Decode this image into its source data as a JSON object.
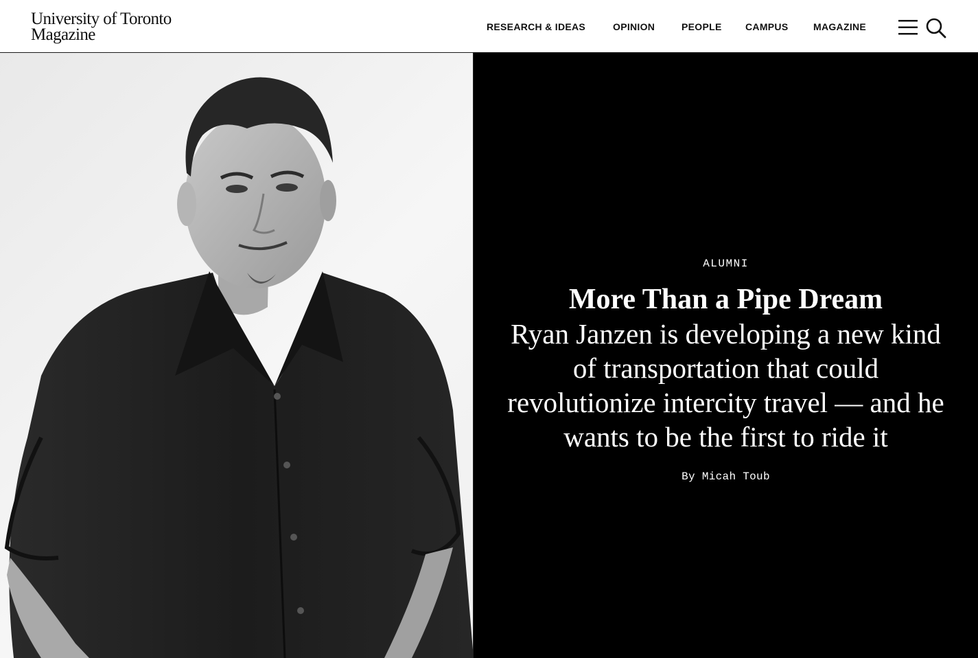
{
  "header": {
    "logo_line1": "University of Toronto",
    "logo_line2": "Magazine",
    "nav": [
      {
        "label": "RESEARCH & IDEAS"
      },
      {
        "label": "OPINION"
      },
      {
        "label": "PEOPLE"
      },
      {
        "label": "CAMPUS"
      },
      {
        "label": "MAGAZINE"
      }
    ],
    "menu_icon": "hamburger-menu-icon",
    "search_icon": "magnifier-icon"
  },
  "hero": {
    "photo": "black-and-white portrait photo",
    "kicker": "ALUMNI",
    "headline": "More Than a Pipe Dream",
    "dek": "Ryan Janzen is developing a new kind of transportation that could revolutionize intercity travel — and he wants to be the first to ride it",
    "byline_prefix": "By",
    "author": "Micah Toub"
  },
  "colors": {
    "text_panel_bg": "#000000",
    "text_panel_fg": "#ffffff",
    "header_bg": "#ffffff",
    "header_fg": "#111111"
  }
}
